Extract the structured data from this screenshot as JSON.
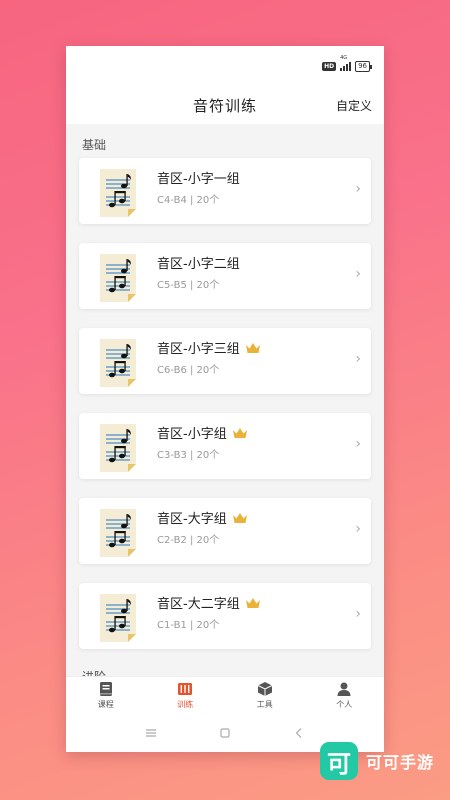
{
  "header": {
    "title": "音符训练",
    "action": "自定义"
  },
  "status": {
    "hd": "HD",
    "network": "4G",
    "battery": "96"
  },
  "sections": {
    "basic": "基础",
    "advanced": "进阶"
  },
  "cards": [
    {
      "title": "音区-小字一组",
      "sub": "C4-B4 | 20个",
      "premium": false
    },
    {
      "title": "音区-小字二组",
      "sub": "C5-B5 | 20个",
      "premium": false
    },
    {
      "title": "音区-小字三组",
      "sub": "C6-B6 | 20个",
      "premium": true
    },
    {
      "title": "音区-小字组",
      "sub": "C3-B3 | 20个",
      "premium": true
    },
    {
      "title": "音区-大字组",
      "sub": "C2-B2 | 20个",
      "premium": true
    },
    {
      "title": "音区-大二字组",
      "sub": "C1-B1 | 20个",
      "premium": true
    }
  ],
  "nav": [
    {
      "label": "课程",
      "icon": "book-icon",
      "active": false
    },
    {
      "label": "训练",
      "icon": "piano-icon",
      "active": true
    },
    {
      "label": "工具",
      "icon": "box-icon",
      "active": false
    },
    {
      "label": "个人",
      "icon": "person-icon",
      "active": false
    }
  ],
  "colors": {
    "accent": "#e2532f",
    "crown": "#e9b33a",
    "brand": "#22c9a4"
  },
  "brand": {
    "name": "可可手游",
    "logo_char": "可"
  }
}
